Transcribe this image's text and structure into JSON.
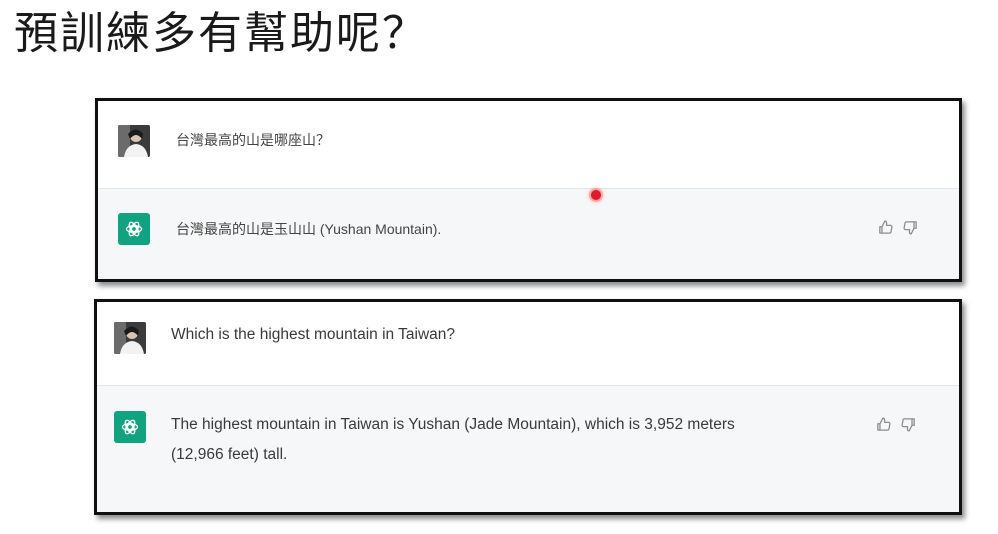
{
  "slide": {
    "title": "預訓練多有幫助呢？"
  },
  "conversation_zh": {
    "user_message": "台灣最高的山是哪座山？",
    "assistant_message": "台灣最高的山是玉山山 (Yushan Mountain).",
    "feedback": {
      "like_icon": "thumbs-up-icon",
      "dislike_icon": "thumbs-down-icon"
    }
  },
  "conversation_en": {
    "user_message": "Which is the highest mountain in Taiwan?",
    "assistant_message_line1": "The highest mountain in Taiwan is Yushan (Jade Mountain), which is 3,952 meters",
    "assistant_message_line2": "(12,966 feet) tall.",
    "feedback": {
      "like_icon": "thumbs-up-icon",
      "dislike_icon": "thumbs-down-icon"
    }
  },
  "colors": {
    "assistant_avatar": "#10a37f",
    "assistant_row_bg": "#f6f7f8",
    "panel_border": "#111111",
    "cursor_dot": "#e0192b"
  }
}
